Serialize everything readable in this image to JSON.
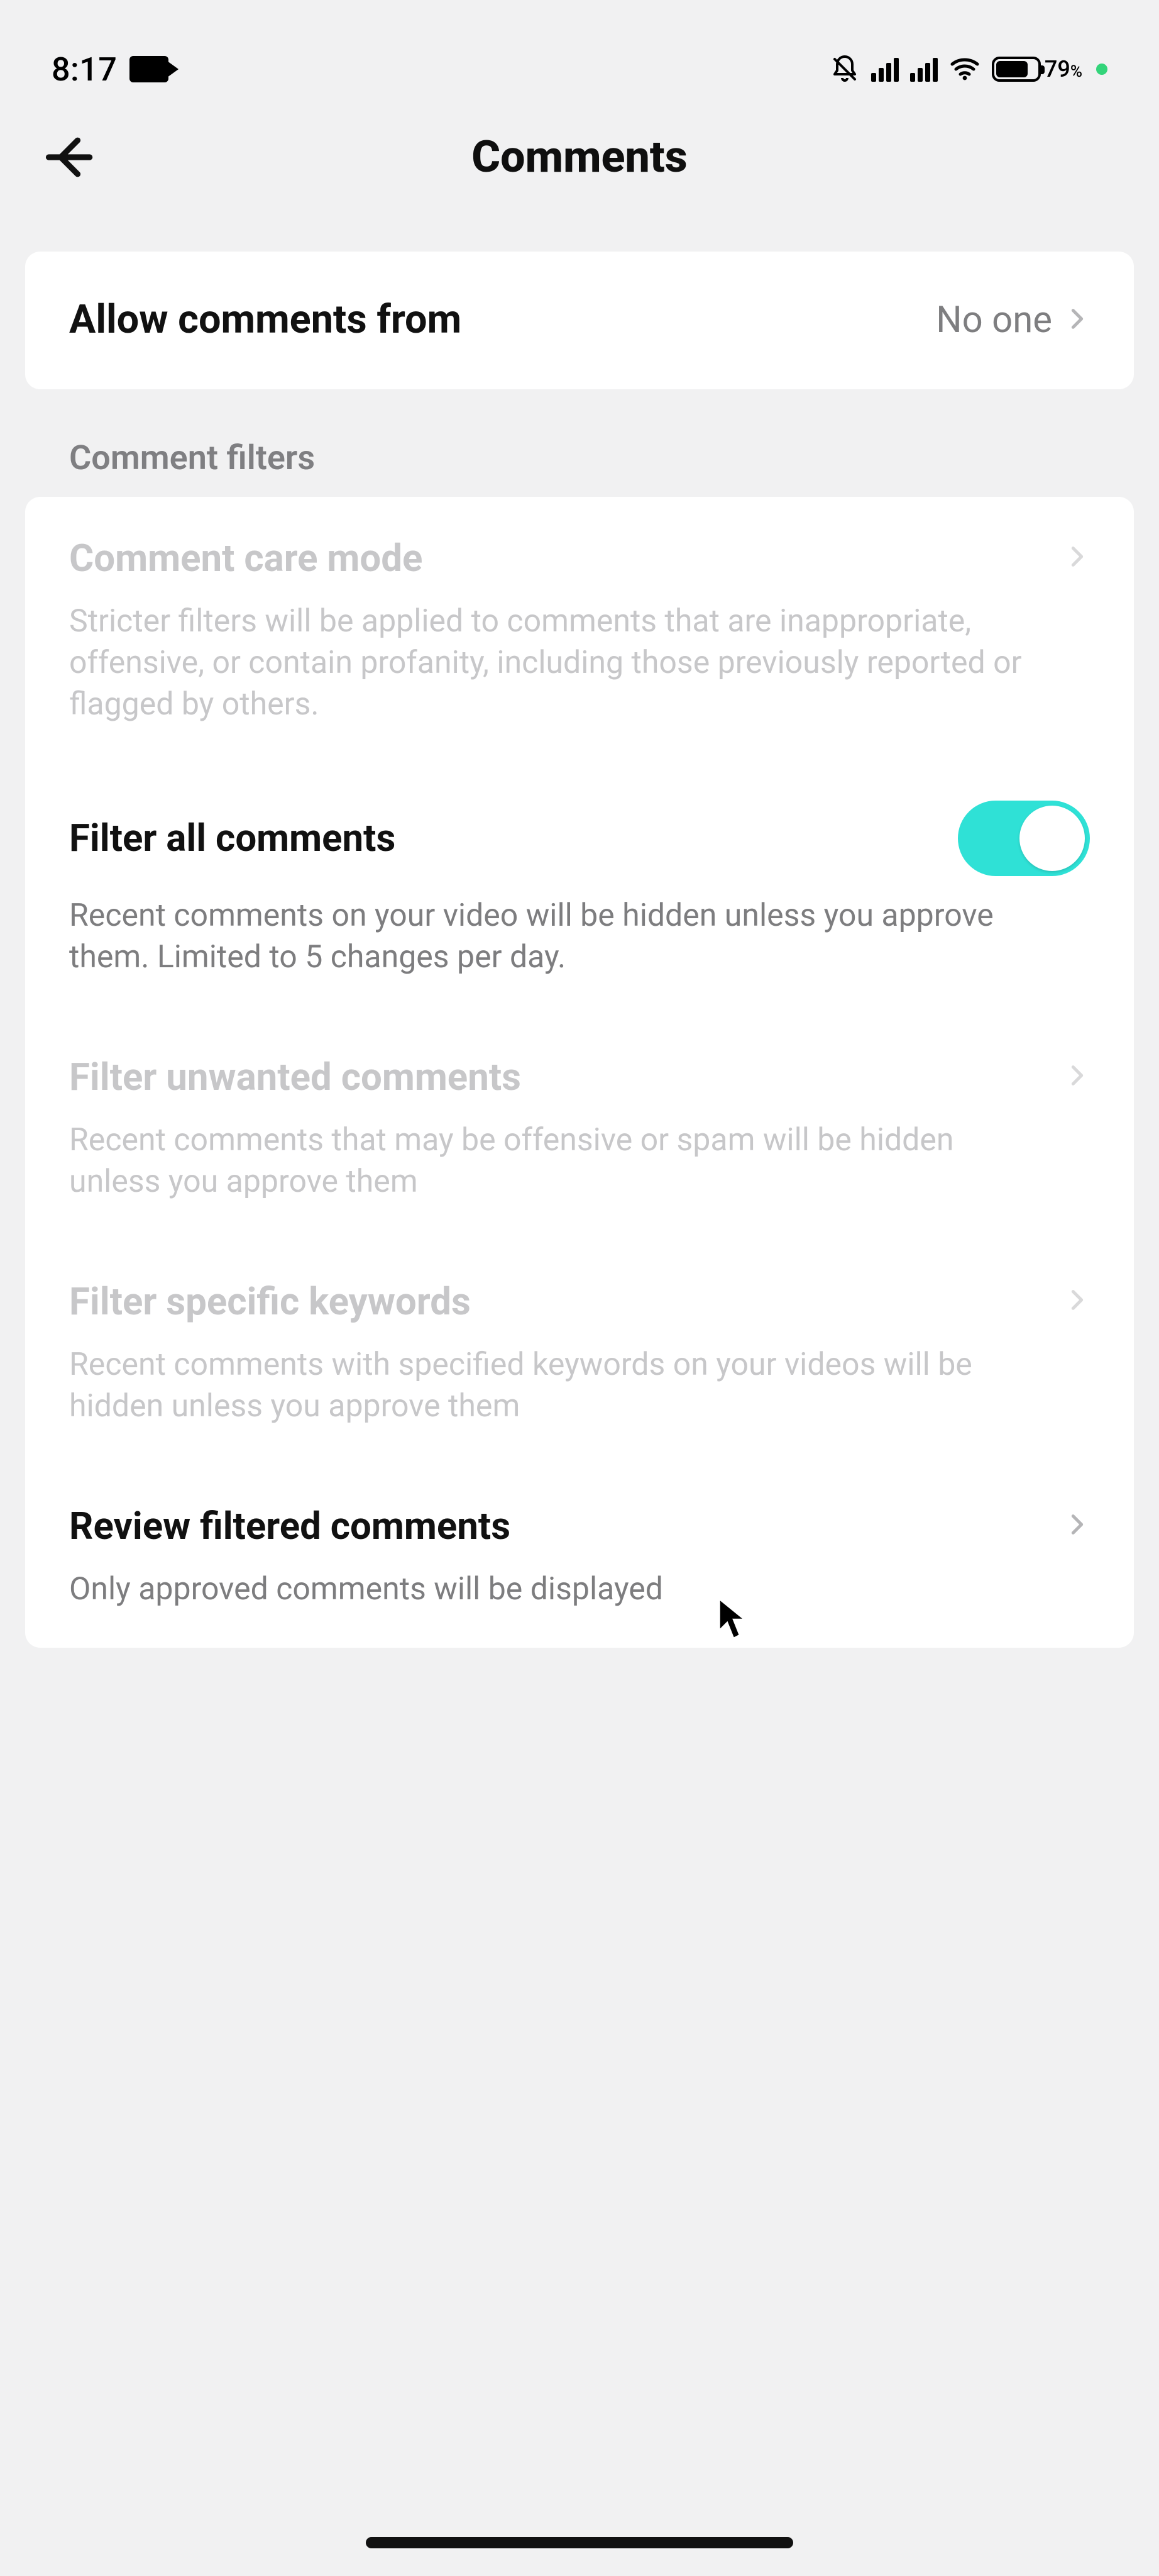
{
  "status_bar": {
    "time": "8:17",
    "battery_pct": "79",
    "battery_pct_sym": "%"
  },
  "header": {
    "title": "Comments"
  },
  "allow_comments": {
    "label": "Allow comments from",
    "value": "No one"
  },
  "section_filters_title": "Comment filters",
  "settings": {
    "care_mode": {
      "title": "Comment care mode",
      "desc": "Stricter filters will be applied to comments that are inappropriate, offensive, or contain profanity, including those previously reported or flagged by others."
    },
    "filter_all": {
      "title": "Filter all comments",
      "desc": "Recent comments on your video will be hidden unless you approve them. Limited to 5 changes per day."
    },
    "filter_unwanted": {
      "title": "Filter unwanted comments",
      "desc": "Recent comments that may be offensive or spam will be hidden unless you approve them"
    },
    "filter_keywords": {
      "title": "Filter specific keywords",
      "desc": "Recent comments with specified keywords on your videos will be hidden unless you approve them"
    },
    "review_filtered": {
      "title": "Review filtered comments",
      "desc": "Only approved comments will be displayed"
    }
  }
}
